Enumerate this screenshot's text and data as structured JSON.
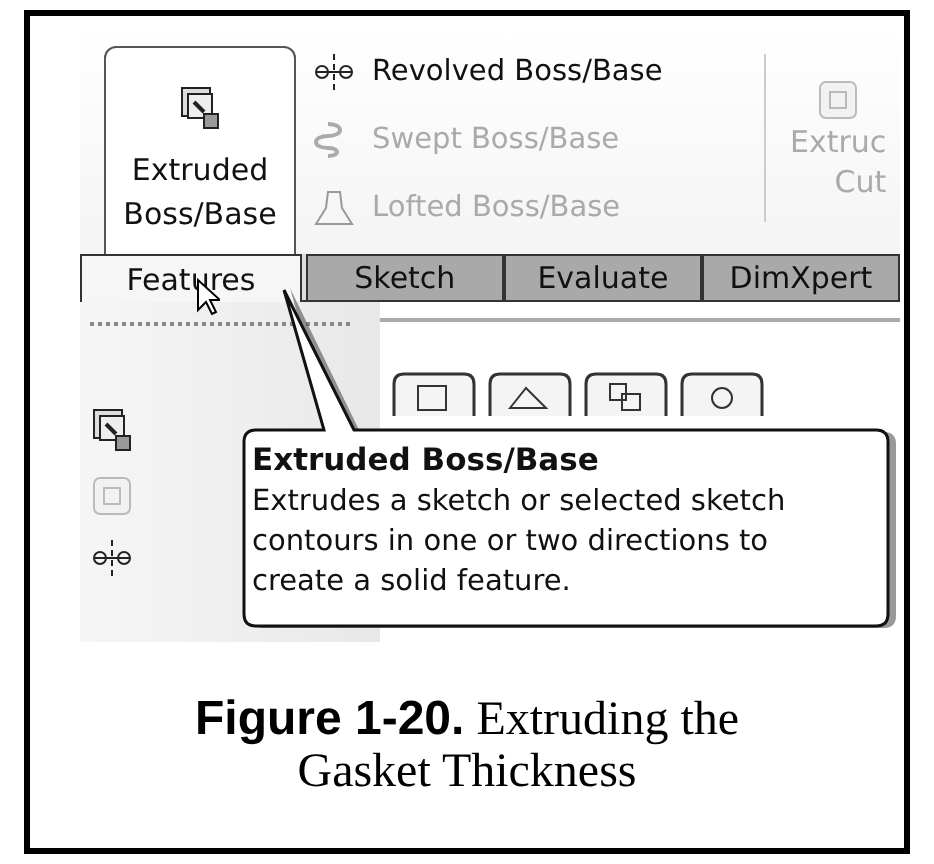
{
  "ribbon": {
    "large_button": {
      "label_lines": [
        "Extruded",
        "Boss/Base"
      ],
      "selected": true
    },
    "small_buttons": [
      {
        "label": "Revolved Boss/Base",
        "disabled": false
      },
      {
        "label": "Swept Boss/Base",
        "disabled": true
      },
      {
        "label": "Lofted Boss/Base",
        "disabled": true
      }
    ],
    "cut_button": {
      "label_lines": [
        "Extruc",
        "Cut"
      ],
      "disabled": true
    }
  },
  "tabs": [
    {
      "label": "Features",
      "selected": true
    },
    {
      "label": "Sketch",
      "selected": false
    },
    {
      "label": "Evaluate",
      "selected": false
    },
    {
      "label": "DimXpert",
      "selected": false
    }
  ],
  "tooltip": {
    "title": "Extruded Boss/Base",
    "lines": [
      "Extrudes a sketch or selected sketch",
      "contours in one or two directions to",
      "create a solid feature."
    ]
  },
  "caption": {
    "text": "**Figure 1-20.** Extruding the Gasket Thickness"
  }
}
